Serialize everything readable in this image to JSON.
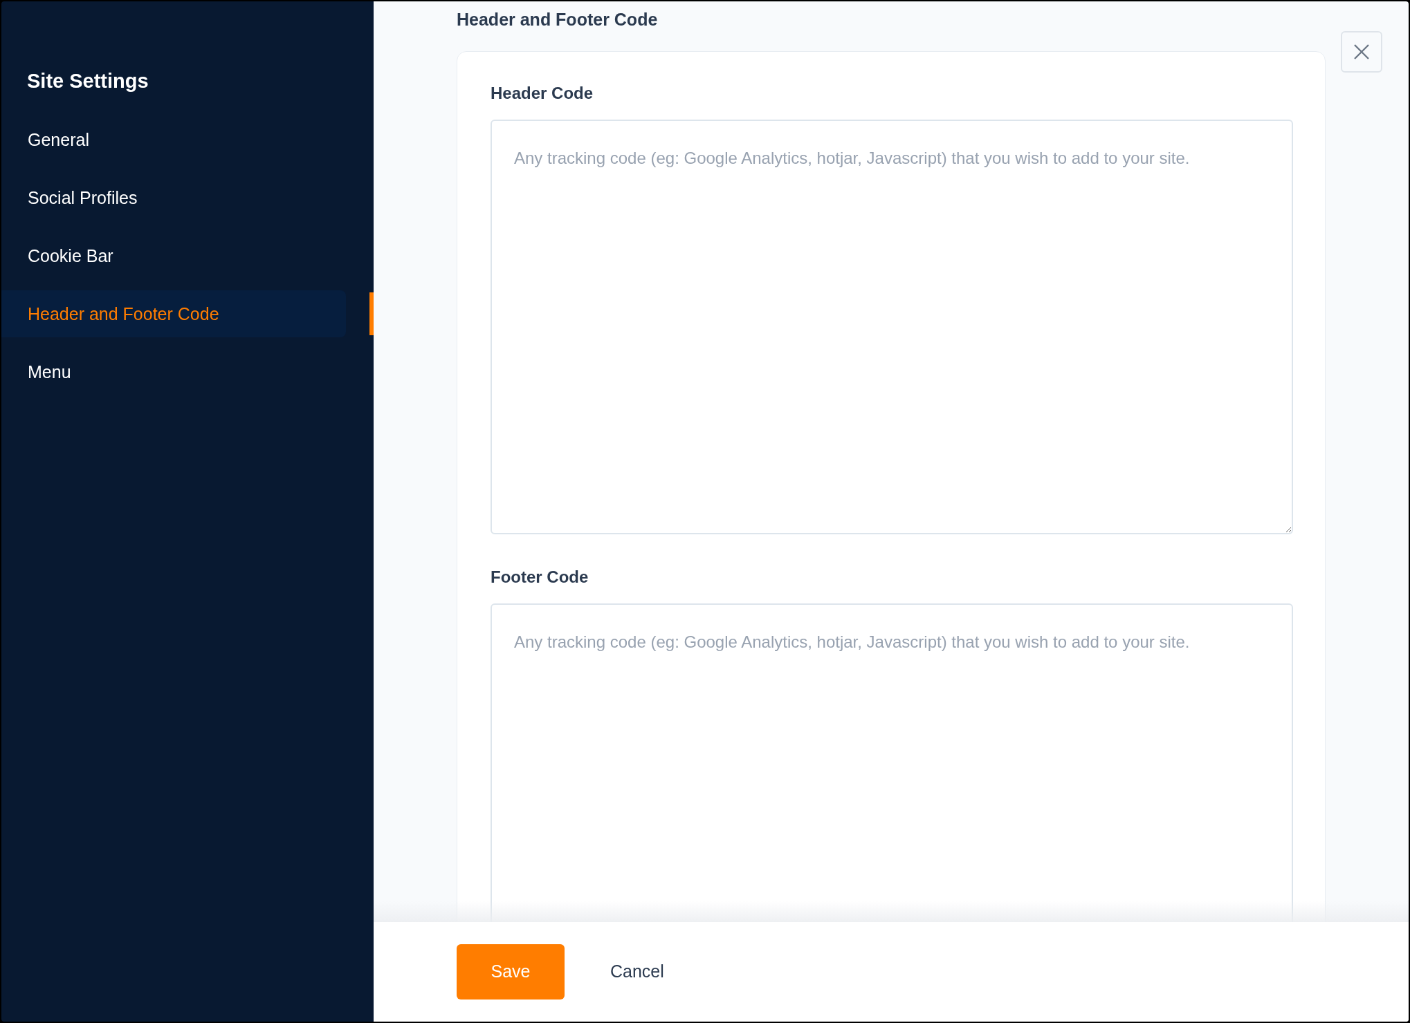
{
  "sidebar": {
    "title": "Site Settings",
    "items": [
      {
        "label": "General",
        "selected": false
      },
      {
        "label": "Social Profiles",
        "selected": false
      },
      {
        "label": "Cookie Bar",
        "selected": false
      },
      {
        "label": "Header and Footer Code",
        "selected": true
      },
      {
        "label": "Menu",
        "selected": false
      }
    ]
  },
  "section_title": "Header and Footer Code",
  "fields": [
    {
      "label": "Header Code",
      "placeholder": "Any tracking code (eg: Google Analytics, hotjar, Javascript) that you wish to add to your site."
    },
    {
      "label": "Footer Code",
      "placeholder": "Any tracking code (eg: Google Analytics, hotjar, Javascript) that you wish to add to your site."
    }
  ],
  "buttons": [
    {
      "kind": "primary",
      "label": "Save"
    },
    {
      "kind": "link",
      "label": "Cancel"
    }
  ]
}
